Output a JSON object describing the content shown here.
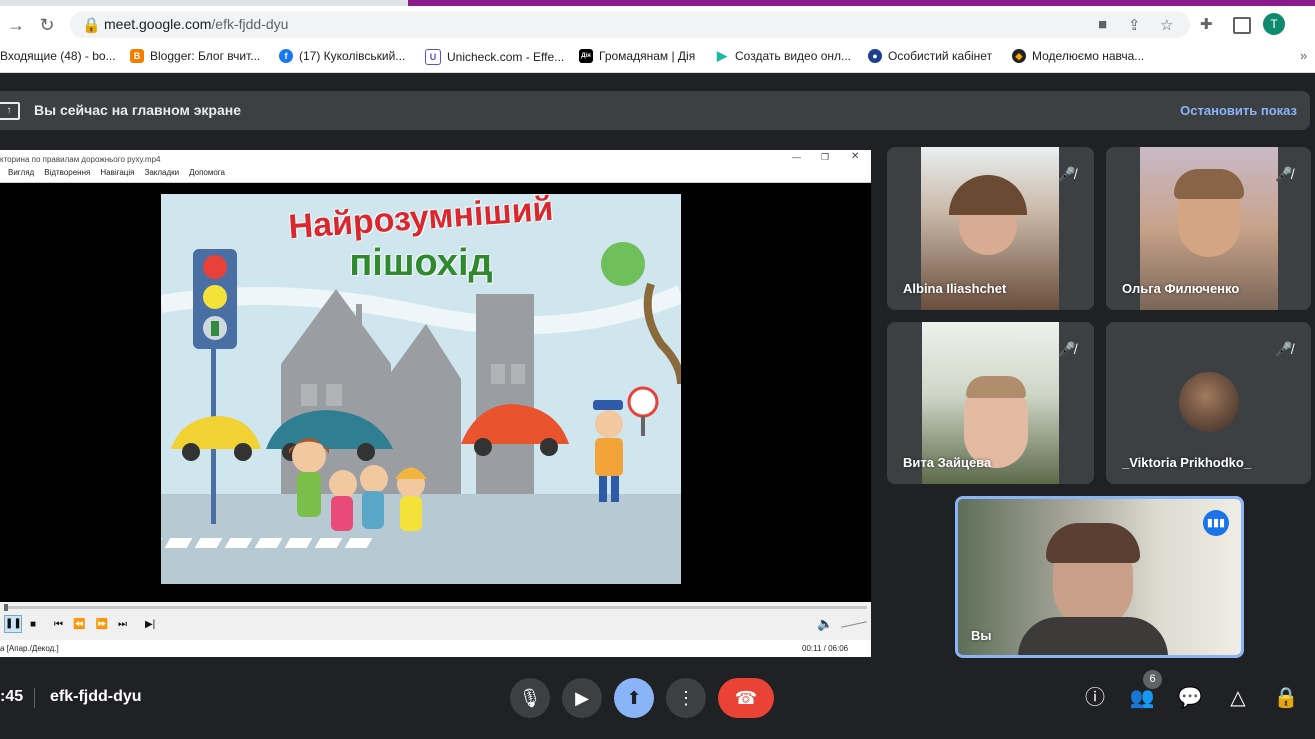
{
  "browser": {
    "url_host": "meet.google.com",
    "url_path": "/efk-fjdd-dyu",
    "avatar_letter": "T",
    "bookmarks": [
      {
        "label": "Входящие (48) - bo...",
        "icon": "mail-icon"
      },
      {
        "label": "Blogger: Блог вчит...",
        "icon": "blogger-icon"
      },
      {
        "label": "(17) Куколівський...",
        "icon": "facebook-icon"
      },
      {
        "label": "Unicheck.com - Effe...",
        "icon": "unicheck-icon"
      },
      {
        "label": "Громадянам | Дія",
        "icon": "diia-icon"
      },
      {
        "label": "Создать видео онл...",
        "icon": "play-icon"
      },
      {
        "label": "Особистий кабінет",
        "icon": "cabinet-icon"
      },
      {
        "label": "Моделюємо навча...",
        "icon": "model-icon"
      }
    ]
  },
  "banner": {
    "text": "Вы сейчас на главном экране",
    "stop_label": "Остановить показ"
  },
  "player": {
    "title": "кторина по правилам дорожнього руху.mp4",
    "menu": [
      "Вигляд",
      "Відтворення",
      "Навігація",
      "Закладки",
      "Допомога"
    ],
    "status_left": "а [Апар./Декод.]",
    "time": "00:11 / 06:06",
    "video_title_1": "Найрозумніший",
    "video_title_2": "пішохід"
  },
  "participants": [
    {
      "name": "Albina Iliashchet",
      "muted": true
    },
    {
      "name": "Ольга Филюченко",
      "muted": true
    },
    {
      "name": "Вита Зайцева",
      "muted": true
    },
    {
      "name": "_Viktoria Prikhodko_",
      "muted": true
    },
    {
      "name": "Вы",
      "speaking": true
    }
  ],
  "bottom": {
    "time": ":45",
    "meeting_code": "efk-fjdd-dyu",
    "participants_count": "6"
  },
  "colors": {
    "accent": "#8ab4f8",
    "end_call": "#ea4335",
    "present_active": "#8ab4f8"
  }
}
